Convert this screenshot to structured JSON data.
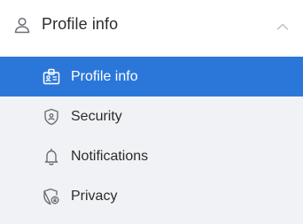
{
  "header": {
    "title": "Profile info",
    "icon": "user-icon",
    "expanded": true
  },
  "menu": {
    "items": [
      {
        "label": "Profile info",
        "icon": "id-card-icon",
        "active": true
      },
      {
        "label": "Security",
        "icon": "shield-icon",
        "active": false
      },
      {
        "label": "Notifications",
        "icon": "bell-icon",
        "active": false
      },
      {
        "label": "Privacy",
        "icon": "privacy-shield-icon",
        "active": false
      }
    ]
  },
  "colors": {
    "accent": "#2b77d9",
    "list_bg": "#f1f2f5",
    "text": "#2b2b2b",
    "icon": "#6b6f76"
  }
}
